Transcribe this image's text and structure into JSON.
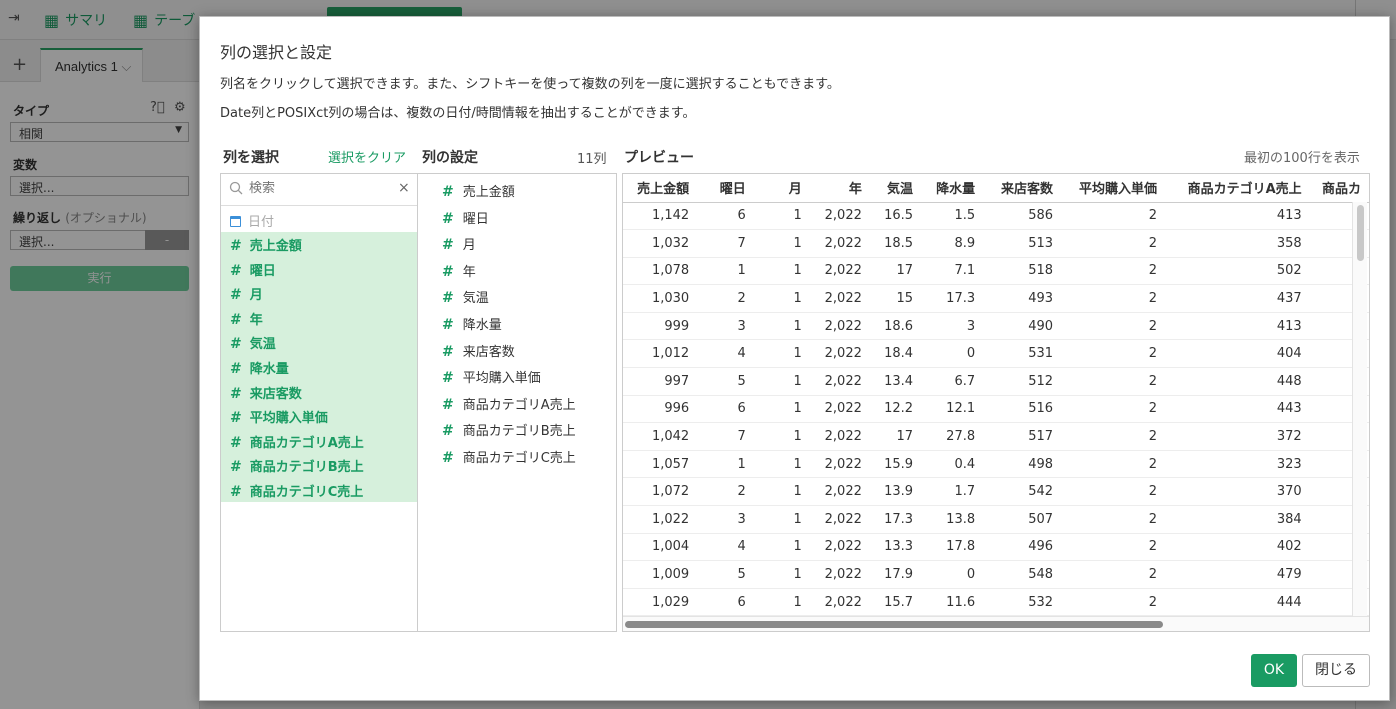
{
  "topbar": {
    "summary_label": "サマリ",
    "table_label": "テーブ"
  },
  "tabs": {
    "add": "+",
    "active": "Analytics 1"
  },
  "sidebar": {
    "type_label": "タイプ",
    "type_value": "相関",
    "variable_label": "変数",
    "variable_placeholder": "選択...",
    "repeat_label": "繰り返し",
    "repeat_optional": "(オプショナル)",
    "repeat_placeholder": "選択...",
    "repeat_dash": "-",
    "run_button": "実行"
  },
  "modal": {
    "title": "列の選択と設定",
    "desc1": "列名をクリックして選択できます。また、シフトキーを使って複数の列を一度に選択することもできます。",
    "desc2": "Date列とPOSIXct列の場合は、複数の日付/時間情報を抽出することができます。",
    "select_title": "列を選択",
    "clear_link": "選択をクリア",
    "settings_title": "列の設定",
    "settings_count": "11列",
    "preview_title": "プレビュー",
    "preview_note": "最初の100行を表示",
    "search_placeholder": "検索",
    "date_column": "日付",
    "selected_columns": [
      "売上金額",
      "曜日",
      "月",
      "年",
      "気温",
      "降水量",
      "来店客数",
      "平均購入単価",
      "商品カテゴリA売上",
      "商品カテゴリB売上",
      "商品カテゴリC売上"
    ],
    "settings_columns": [
      "売上金額",
      "曜日",
      "月",
      "年",
      "気温",
      "降水量",
      "来店客数",
      "平均購入単価",
      "商品カテゴリA売上",
      "商品カテゴリB売上",
      "商品カテゴリC売上"
    ],
    "ok_button": "OK",
    "close_button": "閉じる"
  },
  "preview": {
    "headers": [
      "売上金額",
      "曜日",
      "月",
      "年",
      "気温",
      "降水量",
      "来店客数",
      "平均購入単価",
      "商品カテゴリA売上",
      "商品カ"
    ],
    "rows": [
      [
        "1,142",
        "6",
        "1",
        "2,022",
        "16.5",
        "1.5",
        "586",
        "2",
        "413",
        ""
      ],
      [
        "1,032",
        "7",
        "1",
        "2,022",
        "18.5",
        "8.9",
        "513",
        "2",
        "358",
        ""
      ],
      [
        "1,078",
        "1",
        "1",
        "2,022",
        "17",
        "7.1",
        "518",
        "2",
        "502",
        ""
      ],
      [
        "1,030",
        "2",
        "1",
        "2,022",
        "15",
        "17.3",
        "493",
        "2",
        "437",
        ""
      ],
      [
        "999",
        "3",
        "1",
        "2,022",
        "18.6",
        "3",
        "490",
        "2",
        "413",
        ""
      ],
      [
        "1,012",
        "4",
        "1",
        "2,022",
        "18.4",
        "0",
        "531",
        "2",
        "404",
        ""
      ],
      [
        "997",
        "5",
        "1",
        "2,022",
        "13.4",
        "6.7",
        "512",
        "2",
        "448",
        ""
      ],
      [
        "996",
        "6",
        "1",
        "2,022",
        "12.2",
        "12.1",
        "516",
        "2",
        "443",
        ""
      ],
      [
        "1,042",
        "7",
        "1",
        "2,022",
        "17",
        "27.8",
        "517",
        "2",
        "372",
        ""
      ],
      [
        "1,057",
        "1",
        "1",
        "2,022",
        "15.9",
        "0.4",
        "498",
        "2",
        "323",
        ""
      ],
      [
        "1,072",
        "2",
        "1",
        "2,022",
        "13.9",
        "1.7",
        "542",
        "2",
        "370",
        ""
      ],
      [
        "1,022",
        "3",
        "1",
        "2,022",
        "17.3",
        "13.8",
        "507",
        "2",
        "384",
        ""
      ],
      [
        "1,004",
        "4",
        "1",
        "2,022",
        "13.3",
        "17.8",
        "496",
        "2",
        "402",
        ""
      ],
      [
        "1,009",
        "5",
        "1",
        "2,022",
        "17.9",
        "0",
        "548",
        "2",
        "479",
        ""
      ],
      [
        "1,029",
        "6",
        "1",
        "2,022",
        "15.7",
        "11.6",
        "532",
        "2",
        "444",
        ""
      ]
    ]
  },
  "colors": {
    "accent": "#1a9b63",
    "selected_bg": "#d6f0dc",
    "date_icon": "#3b8fd8"
  },
  "icons": {
    "hash": "#",
    "search": "search-icon",
    "clear": "×",
    "calendar": "calendar-icon"
  }
}
